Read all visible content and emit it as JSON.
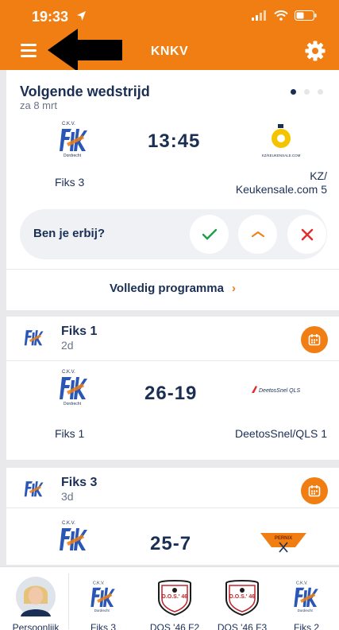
{
  "status_bar": {
    "time": "19:33"
  },
  "header": {
    "title": "KNKV"
  },
  "next_match": {
    "title": "Volgende wedstrijd",
    "date": "za 8 mrt",
    "time": "13:45",
    "home_team": "Fiks 3",
    "away_team_line1": "KZ/",
    "away_team_line2": "Keukensale.com 5",
    "away_logo_text": "KZ/KEUKENSALE.COM",
    "rsvp_question": "Ben je erbij?",
    "full_program_label": "Volledig programma",
    "full_program_chevron": "›"
  },
  "results": [
    {
      "team": "Fiks 1",
      "ago": "2d",
      "score": "26-19",
      "home_team": "Fiks 1",
      "away_team": "DeetosSnel/QLS 1",
      "away_logo_text": "DeetosSnel QLS"
    },
    {
      "team": "Fiks 3",
      "ago": "3d",
      "score": "25-7",
      "away_logo_text": "PERNIX"
    }
  ],
  "logo_lines": {
    "fiks_club": "C.K.V.",
    "fiks_city": "Dordrecht"
  },
  "tabs": [
    {
      "label": "Persoonlijk"
    },
    {
      "label": "Fiks 3"
    },
    {
      "label": "DOS '46 F2",
      "logo_text": "D.O.S.' 46"
    },
    {
      "label": "DOS '46 F3",
      "logo_text": "D.O.S.' 46"
    },
    {
      "label": "Fiks 2"
    }
  ],
  "colors": {
    "accent": "#f07e12",
    "navy": "#1b2f55",
    "confirm": "#1e9e4a",
    "decline": "#e32b2b"
  }
}
